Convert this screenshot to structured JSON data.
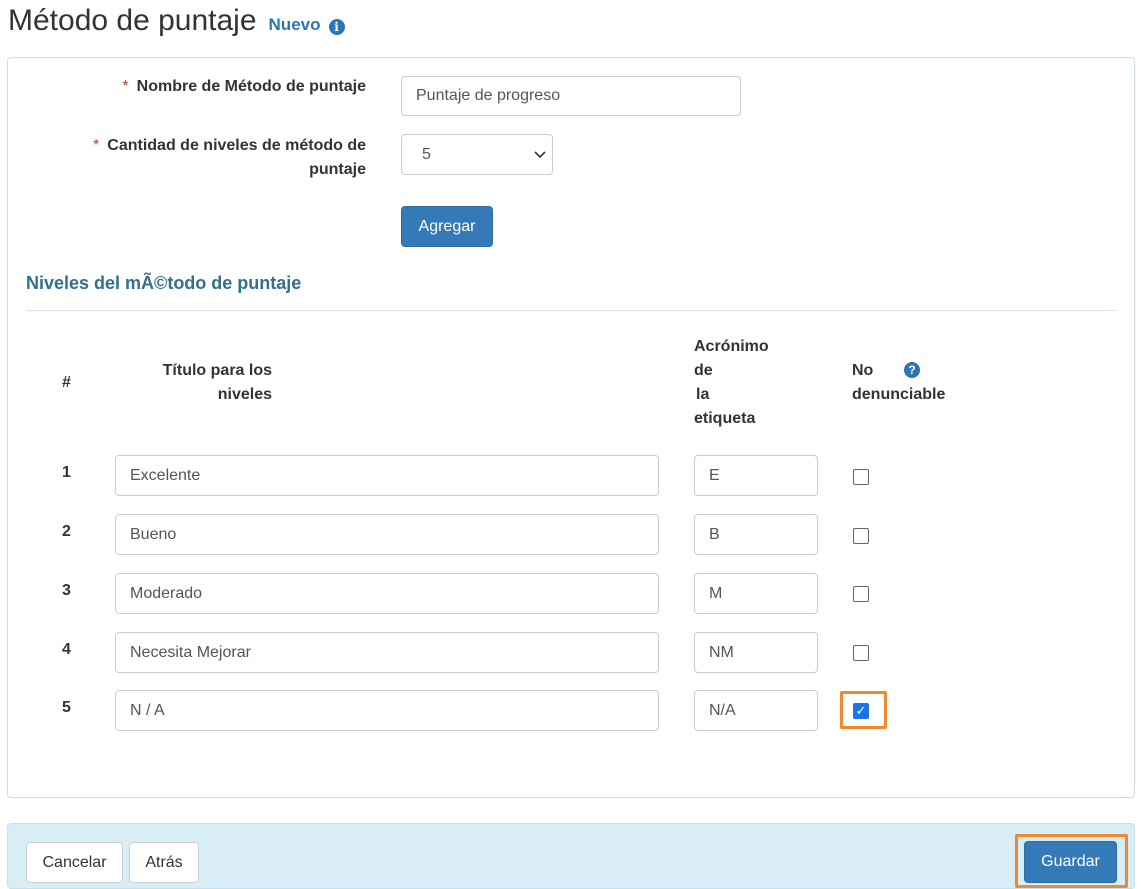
{
  "header": {
    "title": "Método de puntaje",
    "badge": "Nuevo",
    "info_icon": "info-circle-icon"
  },
  "form": {
    "name_label": "Nombre de Método de puntaje",
    "name_value": "Puntaje de progreso",
    "levels_label_line1": "Cantidad de niveles de método de",
    "levels_label_line2": "puntaje",
    "levels_value": "5",
    "required_mark": "*",
    "add_button": "Agregar"
  },
  "levels_section": {
    "title": "Niveles del mÃ©todo de puntaje",
    "columns": {
      "number": "#",
      "title_line1": "Título para los",
      "title_line2": "niveles",
      "acronym_lines": [
        "Acrónimo",
        "de",
        "la",
        "etiqueta"
      ],
      "not_reportable_line1": "No",
      "not_reportable_line2": "denunciable"
    },
    "help_icon": "question-circle-icon",
    "rows": [
      {
        "num": "1",
        "title": "Excelente",
        "acronym": "E",
        "not_reportable": false
      },
      {
        "num": "2",
        "title": "Bueno",
        "acronym": "B",
        "not_reportable": false
      },
      {
        "num": "3",
        "title": "Moderado",
        "acronym": "M",
        "not_reportable": false
      },
      {
        "num": "4",
        "title": "Necesita Mejorar",
        "acronym": "NM",
        "not_reportable": false
      },
      {
        "num": "5",
        "title": "N / A",
        "acronym": "N/A",
        "not_reportable": true
      }
    ]
  },
  "footer": {
    "cancel": "Cancelar",
    "back": "Atrás",
    "save": "Guardar"
  },
  "colors": {
    "primary": "#337ab7",
    "highlight": "#f0882d",
    "footer_bg": "#d9edf7"
  }
}
